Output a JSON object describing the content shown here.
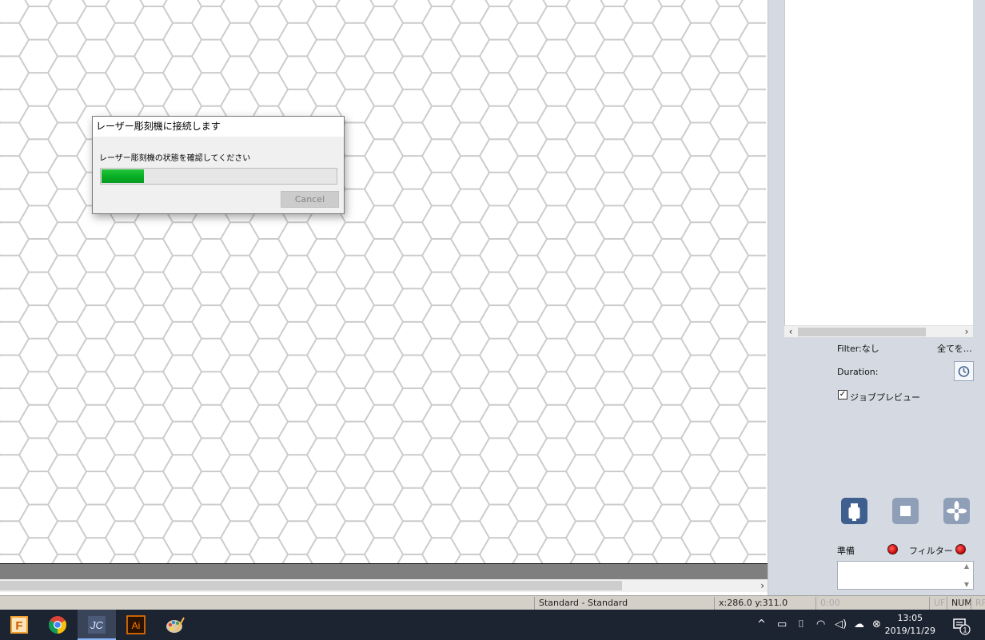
{
  "dialog": {
    "title": "レーザー彫刻機に接続します",
    "message": "レーザー彫刻機の状態を確認してください",
    "progress_fraction": 0.18,
    "cancel_label": "Cancel"
  },
  "panel": {
    "filter_label": "Filter:なし",
    "filter_all_label": "全てを…",
    "duration_label": "Duration:",
    "job_preview_label": "ジョブプレビュー",
    "job_preview_checked": true,
    "ready_label": "準備",
    "filter_status_label": "フィルター",
    "accent_color": "#3f5f8f",
    "status_dot_color": "#d40000"
  },
  "statusbar": {
    "profile": "Standard - Standard",
    "coords": "x:286.0  y:311.0",
    "time": "0:00",
    "uf": "UF",
    "num": "NUM",
    "rf": "RF"
  },
  "taskbar": {
    "apps": [
      "fusion-app-icon",
      "chrome-icon",
      "laser-app-icon",
      "illustrator-icon",
      "paint-icon"
    ],
    "illustrator_label": "Ai",
    "laser_label": "JC",
    "fusion_label": "F",
    "time": "13:05",
    "date": "2019/11/29",
    "notification_count": "1"
  },
  "hexgrid": {
    "line_color": "#cccccc"
  }
}
